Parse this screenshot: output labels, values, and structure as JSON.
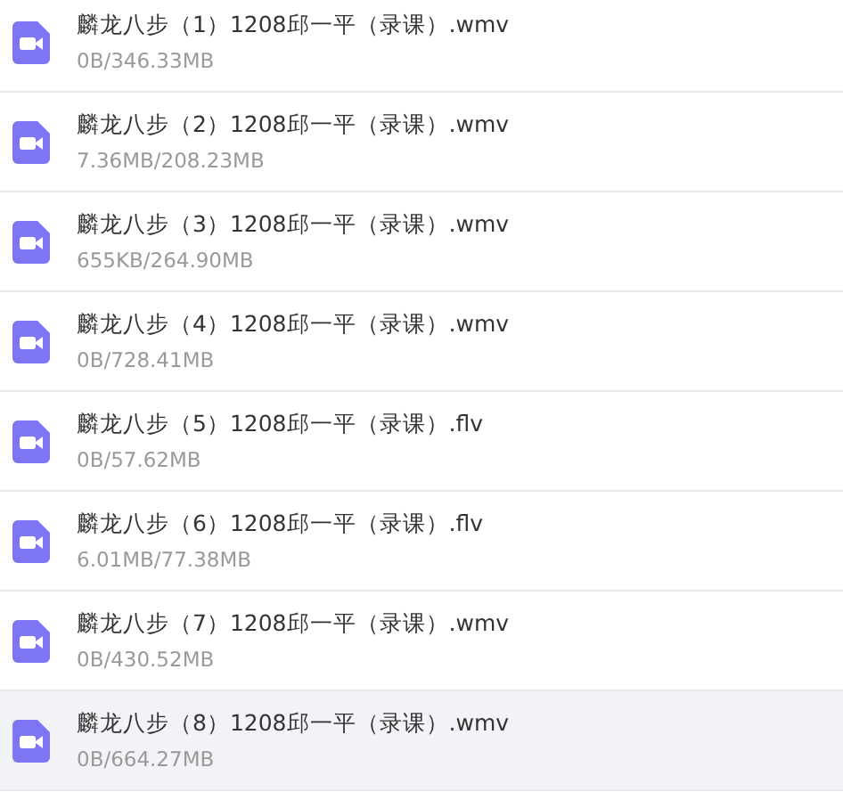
{
  "files": [
    {
      "name": "麟龙八步（1）1208邱一平（录课）.wmv",
      "progress": "0B/346.33MB",
      "selected": false
    },
    {
      "name": "麟龙八步（2）1208邱一平（录课）.wmv",
      "progress": "7.36MB/208.23MB",
      "selected": false
    },
    {
      "name": "麟龙八步（3）1208邱一平（录课）.wmv",
      "progress": "655KB/264.90MB",
      "selected": false
    },
    {
      "name": "麟龙八步（4）1208邱一平（录课）.wmv",
      "progress": "0B/728.41MB",
      "selected": false
    },
    {
      "name": "麟龙八步（5）1208邱一平（录课）.flv",
      "progress": "0B/57.62MB",
      "selected": false
    },
    {
      "name": "麟龙八步（6）1208邱一平（录课）.flv",
      "progress": "6.01MB/77.38MB",
      "selected": false
    },
    {
      "name": "麟龙八步（7）1208邱一平（录课）.wmv",
      "progress": "0B/430.52MB",
      "selected": false
    },
    {
      "name": "麟龙八步（8）1208邱一平（录课）.wmv",
      "progress": "0B/664.27MB",
      "selected": true
    }
  ]
}
